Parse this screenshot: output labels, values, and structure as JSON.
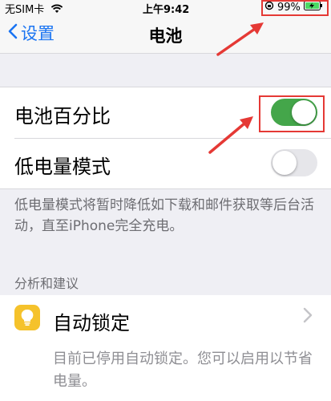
{
  "status_bar": {
    "carrier": "无SIM卡",
    "time": "上午9:42",
    "battery_percent": "99%",
    "icons": [
      "wifi-icon",
      "orientation-lock-icon",
      "battery-charging-icon"
    ]
  },
  "nav": {
    "back_label": "设置",
    "title": "电池"
  },
  "settings": {
    "battery_percentage": {
      "label": "电池百分比",
      "on": true
    },
    "low_power_mode": {
      "label": "低电量模式",
      "on": false
    },
    "footer": "低电量模式将暂时降低如下载和邮件获取等后台活动，直至iPhone完全充电。"
  },
  "insights": {
    "header": "分析和建议",
    "auto_lock": {
      "label": "自动锁定",
      "description": "目前已停用自动锁定。您可以启用以节省电量。",
      "icon": "lightbulb-icon"
    }
  },
  "colors": {
    "accent": "#1a74f2",
    "toggle_on": "#44a64a",
    "annotation": "#e53935",
    "bulb_bg": "#f5c22b"
  }
}
